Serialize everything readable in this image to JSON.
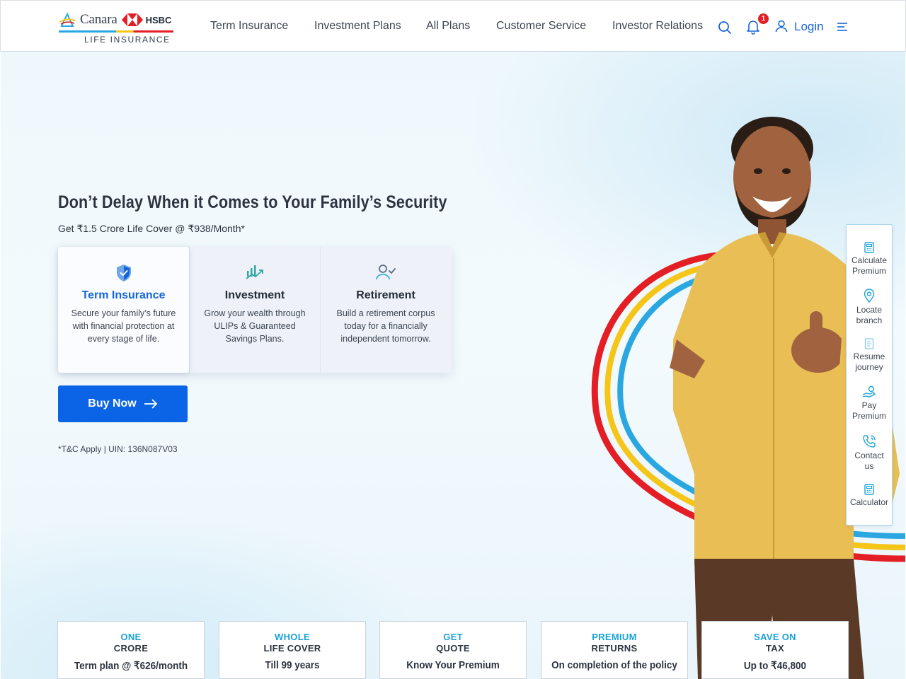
{
  "brand": {
    "name_left": "Canara",
    "name_right": "HSBC",
    "subtitle": "LIFE INSURANCE"
  },
  "nav": {
    "items": [
      "Term Insurance",
      "Investment Plans",
      "All Plans",
      "Customer Service",
      "Investor Relations"
    ],
    "search_icon": "search-icon",
    "bell_icon": "bell-icon",
    "notification_count": "1",
    "login_label": "Login",
    "menu_icon": "hamburger-menu-icon"
  },
  "hero": {
    "headline": "Don’t Delay When it Comes to Your Family’s Security",
    "subline": "Get ₹1.5 Crore Life Cover @ ₹938/Month*",
    "cards": [
      {
        "icon": "shield-check-icon",
        "title": "Term Insurance",
        "desc": "Secure your family’s future with financial protection at every stage of life."
      },
      {
        "icon": "growth-chart-icon",
        "title": "Investment",
        "desc": "Grow your wealth through ULIPs & Guaranteed Savings Plans."
      },
      {
        "icon": "person-check-icon",
        "title": "Retirement",
        "desc": "Build a retirement corpus today for a financially independent tomorrow."
      }
    ],
    "buy_label": "Buy Now",
    "tnc": "*T&C Apply | UIN: 136N087V03"
  },
  "side_menu": [
    {
      "icon": "calculator-icon",
      "label_1": "Calculate",
      "label_2": "Premium"
    },
    {
      "icon": "location-pin-icon",
      "label_1": "Locate",
      "label_2": "branch"
    },
    {
      "icon": "document-icon",
      "label_1": "Resume",
      "label_2": "journey"
    },
    {
      "icon": "hand-coin-icon",
      "label_1": "Pay",
      "label_2": "Premium"
    },
    {
      "icon": "phone-icon",
      "label_1": "Contact",
      "label_2": "us"
    },
    {
      "icon": "calculator-icon",
      "label_1": "Calculator",
      "label_2": ""
    }
  ],
  "stats": [
    {
      "top": "ONE",
      "mid": "CRORE",
      "bot": "Term plan @ ₹626/month"
    },
    {
      "top": "WHOLE",
      "mid": "LIFE COVER",
      "bot": "Till 99 years"
    },
    {
      "top": "GET",
      "mid": "QUOTE",
      "bot": "Know Your Premium"
    },
    {
      "top": "PREMIUM",
      "mid": "RETURNS",
      "bot": "On completion of the policy"
    },
    {
      "top": "SAVE ON",
      "mid": "TAX",
      "bot": "Up to ₹46,800"
    }
  ],
  "colors": {
    "primary_blue": "#0b63e5",
    "link_blue": "#1565d8",
    "accent_cyan": "#1aa3d8",
    "brand_red": "#e31e24",
    "brand_yellow": "#f5c518",
    "brand_sky": "#2aa7e0"
  }
}
